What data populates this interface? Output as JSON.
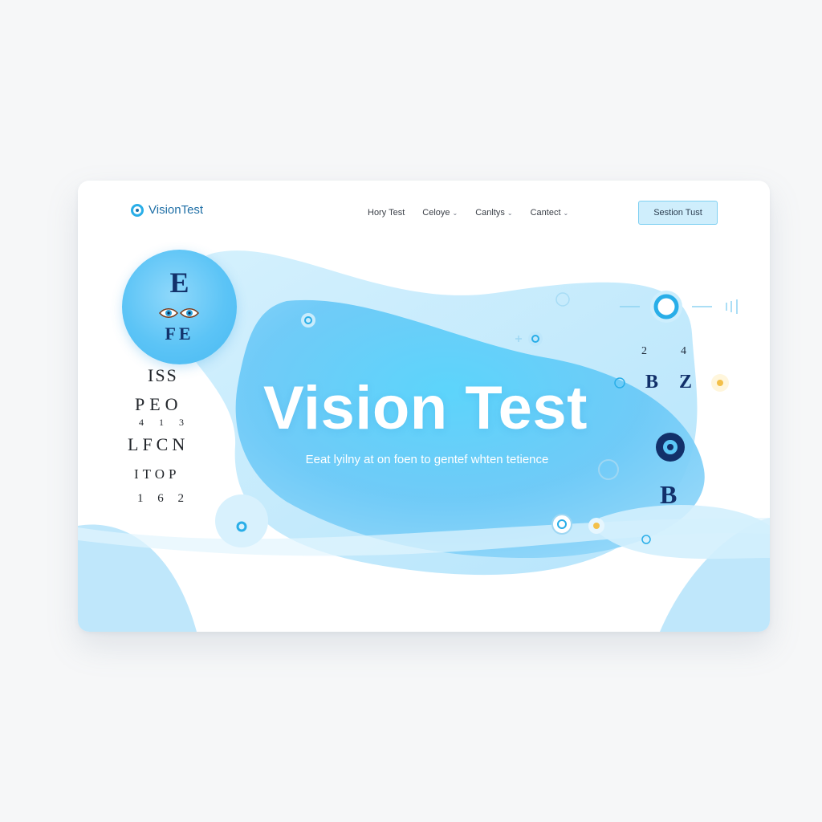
{
  "brand": {
    "name": "VisionTest"
  },
  "nav": {
    "items": [
      {
        "label": "Hory Test",
        "has_dropdown": false
      },
      {
        "label": "Celoye",
        "has_dropdown": true
      },
      {
        "label": "Canltys",
        "has_dropdown": true
      },
      {
        "label": "Cantect",
        "has_dropdown": true
      }
    ],
    "cta_label": "Sestion Tust"
  },
  "badge": {
    "top_letter": "E",
    "bottom_letters": "FE"
  },
  "eye_chart": {
    "rows": [
      "ISS",
      "PEO",
      "4 1 3",
      "LFCN",
      "ITOP",
      "1 6 2"
    ]
  },
  "hero": {
    "title": "Vision Test",
    "subtitle": "Eeat lyilny at on foen to gentef whten tetience"
  },
  "floating": {
    "num_left": "2",
    "num_right": "4",
    "letters_bz": "B Z",
    "letter_b": "B"
  },
  "colors": {
    "accent": "#29aee8",
    "brand_text": "#1f6fa6",
    "hero_blue": "#5cc8f7",
    "chart_navy": "#12306a",
    "cta_bg": "#cfeefc"
  }
}
